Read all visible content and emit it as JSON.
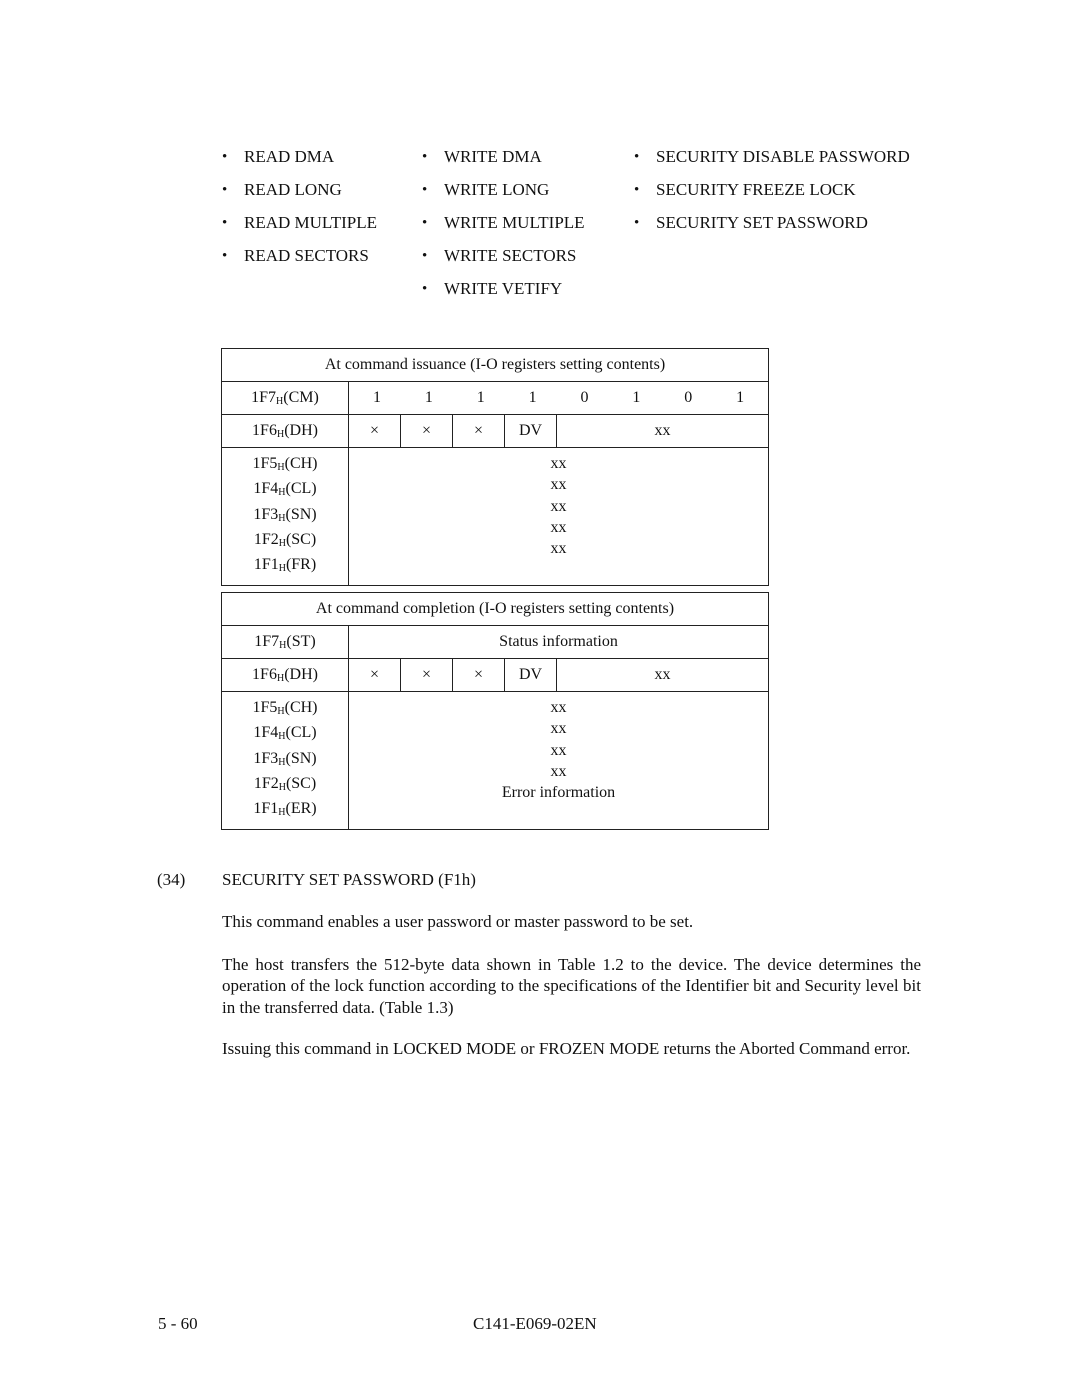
{
  "command_list": {
    "columns": [
      [
        "READ DMA",
        "READ LONG",
        "READ MULTIPLE",
        "READ SECTORS"
      ],
      [
        "WRITE DMA",
        "WRITE LONG",
        "WRITE MULTIPLE",
        "WRITE SECTORS",
        "WRITE VETIFY"
      ],
      [
        "SECURITY DISABLE PASSWORD",
        "SECURITY FREEZE LOCK",
        "SECURITY SET PASSWORD"
      ]
    ],
    "bullet": "•"
  },
  "issuance_table": {
    "title": "At command issuance (I-O registers setting contents)",
    "cm_label": {
      "base": "1F7",
      "sub": "H",
      "reg": "(CM)"
    },
    "cm_bits": [
      "1",
      "1",
      "1",
      "1",
      "0",
      "1",
      "0",
      "1"
    ],
    "dh_label": {
      "base": "1F6",
      "sub": "H",
      "reg": "(DH)"
    },
    "dh_cells": [
      "×",
      "×",
      "×",
      "DV",
      "xx"
    ],
    "rows": [
      {
        "base": "1F5",
        "sub": "H",
        "reg": "(CH)",
        "value": "xx"
      },
      {
        "base": "1F4",
        "sub": "H",
        "reg": "(CL)",
        "value": "xx"
      },
      {
        "base": "1F3",
        "sub": "H",
        "reg": "(SN)",
        "value": "xx"
      },
      {
        "base": "1F2",
        "sub": "H",
        "reg": "(SC)",
        "value": "xx"
      },
      {
        "base": "1F1",
        "sub": "H",
        "reg": "(FR)",
        "value": "xx"
      }
    ]
  },
  "completion_table": {
    "title": "At command completion (I-O registers setting contents)",
    "st_label": {
      "base": "1F7",
      "sub": "H",
      "reg": "(ST)"
    },
    "st_value": "Status information",
    "dh_label": {
      "base": "1F6",
      "sub": "H",
      "reg": "(DH)"
    },
    "dh_cells": [
      "×",
      "×",
      "×",
      "DV",
      "xx"
    ],
    "rows": [
      {
        "base": "1F5",
        "sub": "H",
        "reg": "(CH)",
        "value": "xx"
      },
      {
        "base": "1F4",
        "sub": "H",
        "reg": "(CL)",
        "value": "xx"
      },
      {
        "base": "1F3",
        "sub": "H",
        "reg": "(SN)",
        "value": "xx"
      },
      {
        "base": "1F2",
        "sub": "H",
        "reg": "(SC)",
        "value": "xx"
      },
      {
        "base": "1F1",
        "sub": "H",
        "reg": "(ER)",
        "value": "Error information"
      }
    ]
  },
  "section": {
    "number": "(34)",
    "heading": "SECURITY SET PASSWORD (F1h)",
    "paragraphs": [
      "This command enables a user password or master password to be set.",
      "The host transfers the 512-byte data shown in Table 1.2 to the device.  The device determines the operation of the lock function according to the specifications of the Identifier bit and Security level bit in the transferred data.  (Table 1.3)",
      "Issuing this command in LOCKED MODE or FROZEN MODE returns the Aborted Command error."
    ]
  },
  "footer": {
    "page_number": "5 - 60",
    "doc_code": "C141-E069-02EN"
  }
}
